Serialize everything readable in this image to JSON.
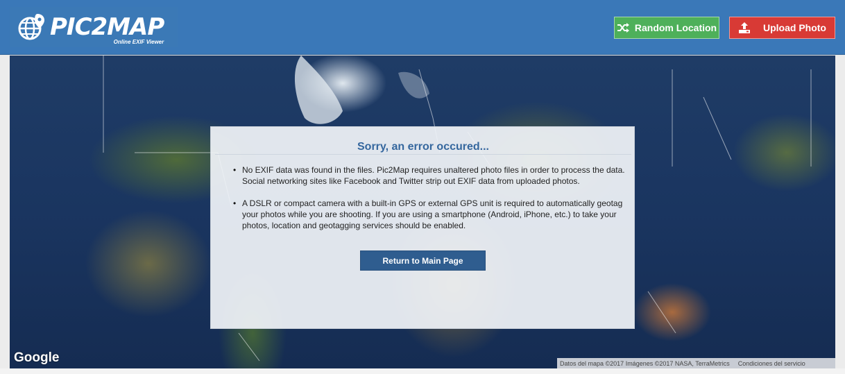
{
  "header": {
    "logo_text": "PIC2MAP",
    "logo_subtitle": "Online EXIF Viewer",
    "random_button_label": "Random Location",
    "upload_button_label": "Upload Photo"
  },
  "map": {
    "google_label": "Google",
    "attribution": "Datos del mapa ©2017 Imágenes ©2017 NASA, TerraMetrics",
    "terms": "Condiciones del servicio"
  },
  "error_panel": {
    "title": "Sorry, an error occured...",
    "items": [
      "No EXIF data was found in the files. Pic2Map requires unaltered photo files in order to process the data. Social networking sites like Facebook and Twitter strip out EXIF data from uploaded photos.",
      "A DSLR or compact camera with a built-in GPS or external GPS unit is required to automatically geotag your photos while you are shooting. If you are using a smartphone (Android, iPhone, etc.) to take your photos, location and geotagging services should be enabled."
    ],
    "return_button_label": "Return to Main Page"
  },
  "colors": {
    "header_bg": "#3a78b8",
    "random_button": "#4eb05a",
    "upload_button": "#d83a35",
    "return_button": "#2f5d8f",
    "title_color": "#35679e"
  },
  "icons": {
    "logo": "globe-icon",
    "random": "shuffle-icon",
    "upload": "upload-icon"
  }
}
